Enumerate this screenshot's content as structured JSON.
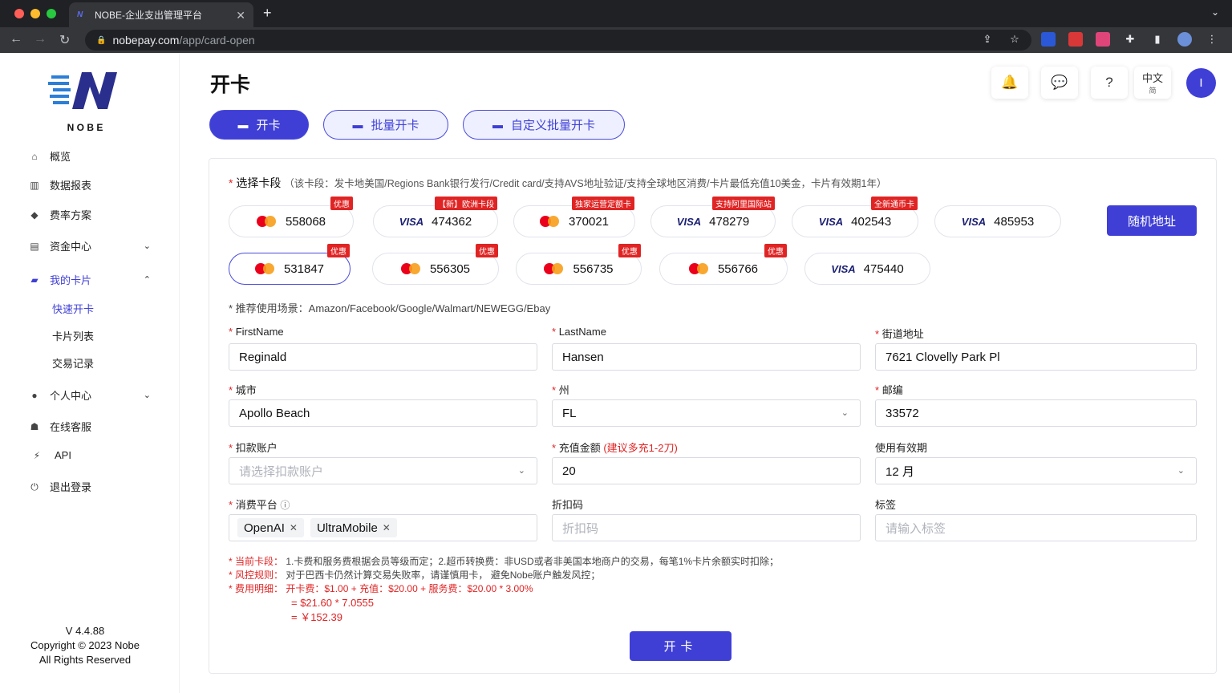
{
  "browser": {
    "tab_title": "NOBE-企业支出管理平台",
    "url_host": "nobepay.com",
    "url_path": "/app/card-open"
  },
  "sidebar": {
    "logo_text": "N O B E",
    "items": [
      {
        "label": "概览",
        "icon": "home-icon"
      },
      {
        "label": "数据报表",
        "icon": "chart-icon"
      },
      {
        "label": "费率方案",
        "icon": "diamond-icon"
      },
      {
        "label": "资金中心",
        "icon": "wallet-icon"
      },
      {
        "label": "我的卡片",
        "icon": "card-icon"
      },
      {
        "label": "个人中心",
        "icon": "user-icon"
      },
      {
        "label": "在线客服",
        "icon": "support-icon"
      },
      {
        "label": "API",
        "icon": "api-icon"
      },
      {
        "label": "退出登录",
        "icon": "power-icon"
      }
    ],
    "sub_items": [
      "快速开卡",
      "卡片列表",
      "交易记录"
    ],
    "version": "V 4.4.88",
    "copyright": "Copyright © 2023 Nobe",
    "rights": "All Rights Reserved"
  },
  "header": {
    "title": "开卡",
    "lang": "中文",
    "lang_sub": "简",
    "avatar_letter": "I"
  },
  "tabs": [
    "开卡",
    "批量开卡",
    "自定义批量开卡"
  ],
  "card_section": {
    "label": "选择卡段",
    "hint": "（该卡段：发卡地美国/Regions Bank银行发行/Credit card/支持AVS地址验证/支持全球地区消费/卡片最低充值10美金，卡片有效期1年）",
    "random_button": "随机地址",
    "cards": [
      {
        "bin": "558068",
        "brand": "mastercard",
        "tag": "优惠"
      },
      {
        "bin": "474362",
        "brand": "visa",
        "tag": "【新】欧洲卡段"
      },
      {
        "bin": "370021",
        "brand": "mastercard",
        "tag": "独家运营定额卡"
      },
      {
        "bin": "478279",
        "brand": "visa",
        "tag": "支持阿里国际站"
      },
      {
        "bin": "402543",
        "brand": "visa",
        "tag": "全新通币卡"
      },
      {
        "bin": "485953",
        "brand": "visa",
        "tag": ""
      },
      {
        "bin": "531847",
        "brand": "mastercard",
        "tag": "优惠",
        "selected": true
      },
      {
        "bin": "556305",
        "brand": "mastercard",
        "tag": "优惠"
      },
      {
        "bin": "556735",
        "brand": "mastercard",
        "tag": "优惠"
      },
      {
        "bin": "556766",
        "brand": "mastercard",
        "tag": "优惠"
      },
      {
        "bin": "475440",
        "brand": "visa",
        "tag": ""
      }
    ],
    "visa_text": "VISA",
    "scene": "* 推荐使用场景：Amazon/Facebook/Google/Walmart/NEWEGG/Ebay"
  },
  "form": {
    "first_name": {
      "label": "FirstName",
      "value": "Reginald"
    },
    "last_name": {
      "label": "LastName",
      "value": "Hansen"
    },
    "street": {
      "label": "街道地址",
      "value": "7621 Clovelly Park Pl"
    },
    "city": {
      "label": "城市",
      "value": "Apollo Beach"
    },
    "state": {
      "label": "州",
      "value": "FL"
    },
    "zip": {
      "label": "邮编",
      "value": "33572"
    },
    "account": {
      "label": "扣款账户",
      "placeholder": "请选择扣款账户"
    },
    "amount": {
      "label": "充值金额",
      "warn": "(建议多充1-2刀)",
      "value": "20"
    },
    "validity": {
      "label": "使用有效期",
      "value": "12 月"
    },
    "platform": {
      "label": "消费平台",
      "chips": [
        "OpenAI",
        "UltraMobile"
      ]
    },
    "discount": {
      "label": "折扣码",
      "placeholder": "折扣码"
    },
    "tags": {
      "label": "标签",
      "placeholder": "请输入标签"
    }
  },
  "notes": {
    "card_key": "* 当前卡段：",
    "card_text": "1.卡费和服务费根据会员等级而定；2.超币转换费：非USD或者非美国本地商户的交易，每笔1%卡片余额实时扣除；",
    "risk_key": "* 风控规则：",
    "risk_text": "对于巴西卡仍然计算交易失败率，请谨慎用卡， 避免Nobe账户触发风控；",
    "fee_key": "* 费用明细：",
    "fee_line1": "开卡费：$1.00 + 充值：$20.00 + 服务费：$20.00 * 3.00%",
    "fee_line2": "= $21.60 * 7.0555",
    "fee_line3": "= ￥152.39"
  },
  "submit_label": "开卡",
  "colors": {
    "primary": "#3f3fd6",
    "danger": "#e02424"
  }
}
